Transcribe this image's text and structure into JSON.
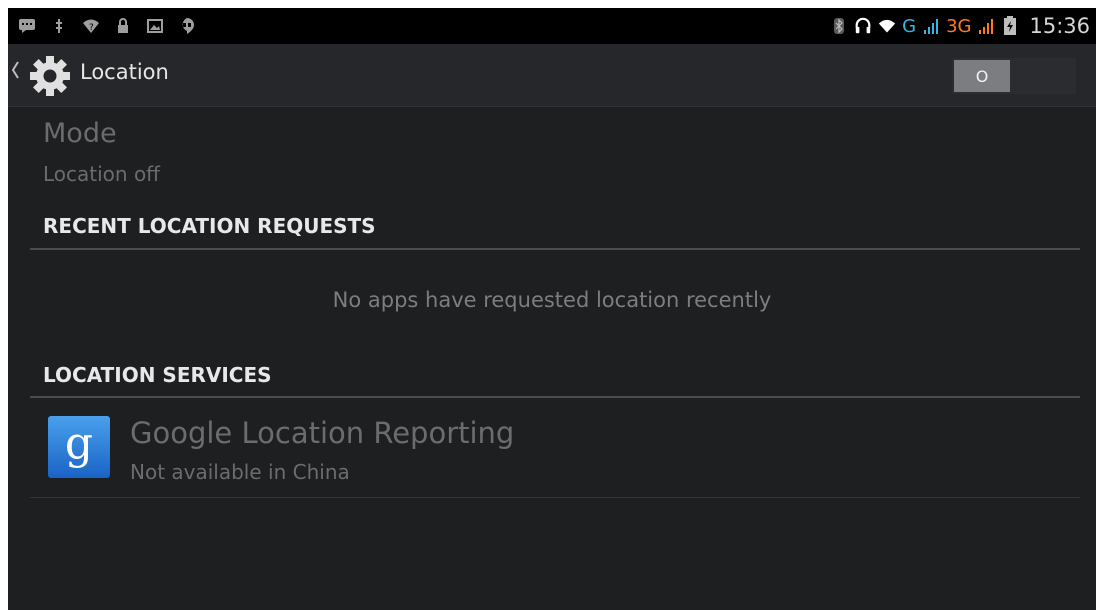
{
  "status_bar": {
    "left_icons": [
      "chat-icon",
      "usb-debug-icon",
      "wifi-notification-icon",
      "lock-icon",
      "image-icon",
      "hangouts-icon"
    ],
    "right_icons": [
      "bluetooth-icon",
      "headset-icon",
      "wifi-icon"
    ],
    "network_g": "G",
    "network_3g": "3G",
    "time": "15:36"
  },
  "action_bar": {
    "title": "Location",
    "toggle_state_label": "O"
  },
  "mode": {
    "title": "Mode",
    "value": "Location off"
  },
  "recent_requests": {
    "header": "RECENT LOCATION REQUESTS",
    "empty_message": "No apps have requested location recently"
  },
  "services": {
    "header": "LOCATION SERVICES",
    "items": [
      {
        "icon": "google-g-icon",
        "icon_glyph": "g",
        "title": "Google Location Reporting",
        "subtitle": "Not available in China"
      }
    ]
  },
  "colors": {
    "background": "#1d1f21",
    "accent_g": "#33b5e5",
    "accent_3g": "#ff7a1a"
  }
}
